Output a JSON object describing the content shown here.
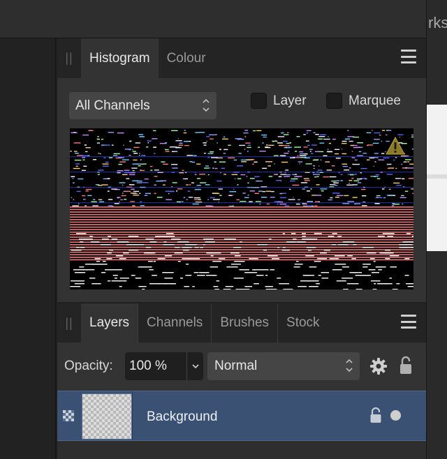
{
  "app": {
    "doc_title_fragment": "rks"
  },
  "histogram_panel": {
    "tabs": [
      {
        "label": "Histogram",
        "active": true
      },
      {
        "label": "Colour",
        "active": false
      }
    ],
    "channel_select": {
      "value": "All Channels"
    },
    "checkboxes": [
      {
        "label": "Layer",
        "checked": false
      },
      {
        "label": "Marquee",
        "checked": false
      }
    ],
    "warning_icon": "warning-triangle-icon"
  },
  "layers_panel": {
    "tabs": [
      {
        "label": "Layers",
        "active": true
      },
      {
        "label": "Channels",
        "active": false
      },
      {
        "label": "Brushes",
        "active": false
      },
      {
        "label": "Stock",
        "active": false
      }
    ],
    "opacity": {
      "label": "Opacity:",
      "value": "100 %"
    },
    "blend_mode": {
      "value": "Normal"
    },
    "layers": [
      {
        "name": "Background",
        "locked": true,
        "visible": true,
        "selected": true
      }
    ]
  },
  "colors": {
    "panel_bg": "#333333",
    "tab_bar_bg": "#242424",
    "selection_blue": "#3a5173",
    "histogram_bg": "#000000"
  }
}
